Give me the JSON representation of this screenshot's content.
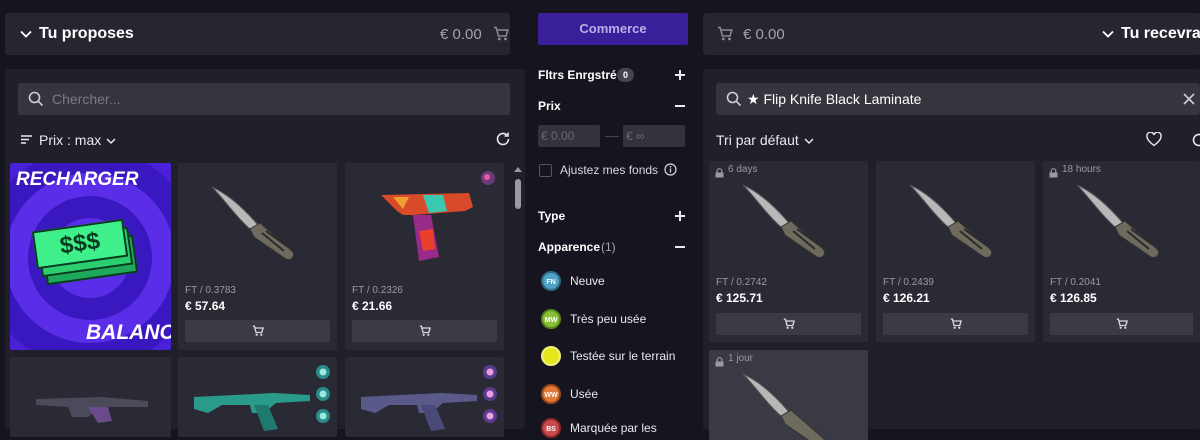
{
  "left": {
    "title": "Tu proposes",
    "total": "€ 0.00",
    "search_placeholder": "Chercher...",
    "sort_label": "Prix : max",
    "promo": {
      "top": "RECHARGER",
      "middle": "$$$",
      "bottom": "BALANCE"
    },
    "items": [
      {
        "wear": "FT / 0.3783",
        "price": "€ 57.64"
      },
      {
        "wear": "FT / 0.2326",
        "price": "€ 21.66"
      }
    ]
  },
  "middle": {
    "trade_button": "Commerce",
    "saved_filters": "Fltrs Enrgstré",
    "saved_count": "0",
    "price_label": "Prix",
    "min_placeholder": "€ 0.00",
    "max_placeholder": "€ ∞",
    "adjust_funds": "Ajustez mes fonds",
    "type_label": "Type",
    "appearance_label": "Apparence",
    "appearance_count": "(1)",
    "wear_options": [
      {
        "abbr": "FN",
        "label": "Neuve",
        "color": "#4fa3c4"
      },
      {
        "abbr": "MW",
        "label": "Très peu usée",
        "color": "#8bbf3a"
      },
      {
        "abbr": "FT",
        "label": "Testée sur le terrain",
        "color": "#e6e61e"
      },
      {
        "abbr": "WW",
        "label": "Usée",
        "color": "#e07a3a"
      },
      {
        "abbr": "BS",
        "label": "Marquée par les",
        "color": "#c74b4b"
      }
    ]
  },
  "right": {
    "total": "€ 0.00",
    "title": "Tu recevras",
    "search_value": "★ Flip Knife Black Laminate",
    "sort_label": "Tri par défaut",
    "items": [
      {
        "time": "6 days",
        "wear": "FT / 0.2742",
        "price": "€ 125.71"
      },
      {
        "time": "",
        "wear": "FT / 0.2439",
        "price": "€ 126.21"
      },
      {
        "time": "18 hours",
        "wear": "FT / 0.2041",
        "price": "€ 126.85"
      },
      {
        "time": "1 jour",
        "wear": "",
        "price": ""
      }
    ]
  }
}
